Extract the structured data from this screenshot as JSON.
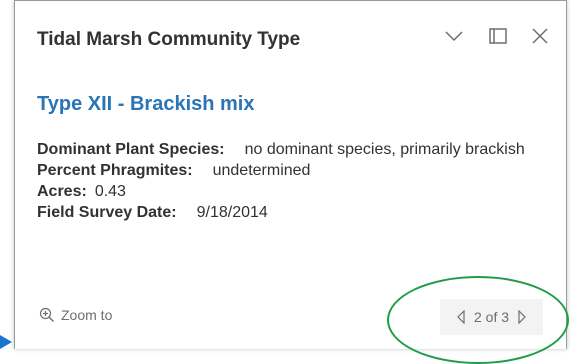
{
  "popup": {
    "title": "Tidal Marsh Community Type",
    "feature_title": "Type XII - Brackish mix",
    "attributes": [
      {
        "label": "Dominant Plant Species:",
        "value": "no dominant species, primarily brackish"
      },
      {
        "label": "Percent Phragmites:",
        "value": "undetermined"
      },
      {
        "label": "Acres:",
        "value": "0.43"
      },
      {
        "label": "Field Survey Date:",
        "value": "9/18/2014"
      }
    ],
    "zoom_label": "Zoom to",
    "pager": {
      "text": "2 of 3"
    },
    "icons": {
      "collapse": "chevron-down-icon",
      "dock": "dock-icon",
      "close": "close-icon",
      "zoom": "zoom-in-icon",
      "prev": "triangle-left-icon",
      "next": "triangle-right-icon"
    }
  },
  "colors": {
    "title_text": "#323232",
    "feature_title": "#2a74b8",
    "annotation_ellipse": "#1f9c4a",
    "marker": "#1a75cf"
  }
}
